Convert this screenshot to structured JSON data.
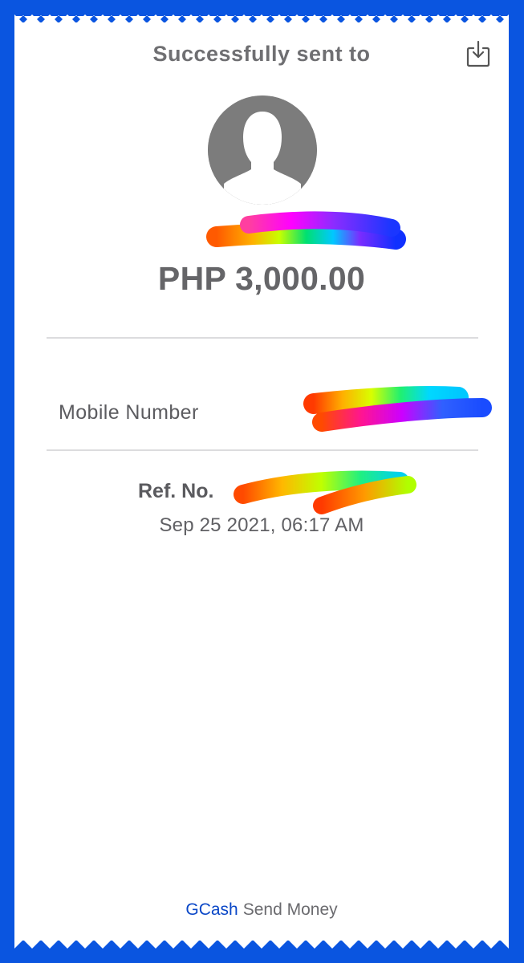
{
  "header": {
    "title": "Successfully sent to",
    "download_icon": "download-icon"
  },
  "recipient": {
    "avatar_icon": "avatar-placeholder-icon",
    "amount": "PHP 3,000.00"
  },
  "details": {
    "mobile_label": "Mobile Number",
    "ref_label": "Ref. No.",
    "datetime": "Sep 25 2021, 06:17 AM"
  },
  "footer": {
    "brand": "GCash",
    "label": "Send Money"
  },
  "colors": {
    "background_blue": "#0a55e0",
    "text_gray": "#6f6f72",
    "brand_blue": "#0a47c7"
  }
}
